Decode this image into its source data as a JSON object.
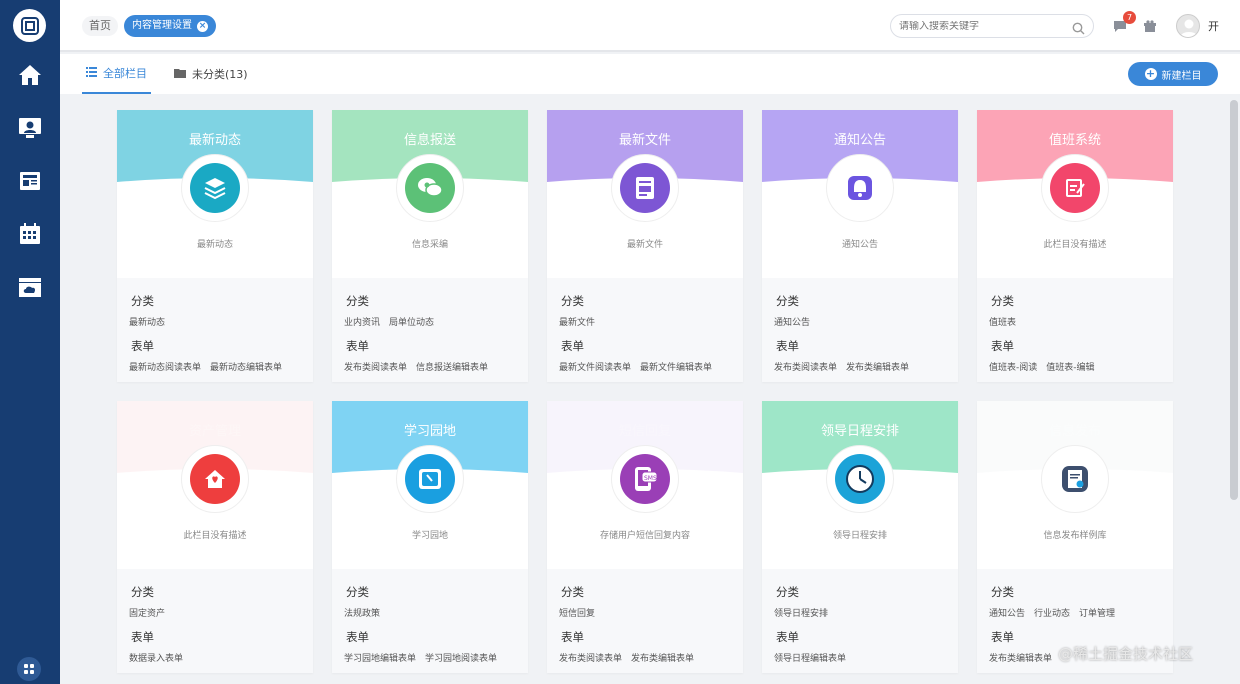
{
  "topbar": {
    "breadcrumb_home": "首页",
    "breadcrumb_active": "内容管理设置",
    "search_placeholder": "请输入搜索关键字",
    "message_count": "7",
    "user_name": "开"
  },
  "tabs": {
    "all_label": "全部栏目",
    "uncategorized_label": "未分类(13)",
    "new_button_label": "新建栏目"
  },
  "nav_icons": [
    "logo-icon",
    "home-icon",
    "user-monitor-icon",
    "newspaper-icon",
    "calendar-icon",
    "cloud-folder-icon",
    "apps-icon"
  ],
  "section_labels": {
    "category": "分类",
    "form": "表单"
  },
  "cards": [
    {
      "title": "最新动态",
      "desc": "最新动态",
      "categories": [
        "最新动态"
      ],
      "forms": [
        "最新动态阅读表单",
        "最新动态编辑表单"
      ],
      "banner_color": "#7fd3e3",
      "icon_color": "#1aa9c4",
      "icon": "layers-icon"
    },
    {
      "title": "信息报送",
      "desc": "信息采编",
      "categories": [
        "业内资讯",
        "局单位动态"
      ],
      "forms": [
        "发布类阅读表单",
        "信息报送编辑表单"
      ],
      "banner_color": "#a4e4bf",
      "icon_color": "#5cc177",
      "icon": "chat-bubbles-icon"
    },
    {
      "title": "最新文件",
      "desc": "最新文件",
      "categories": [
        "最新文件"
      ],
      "forms": [
        "最新文件阅读表单",
        "最新文件编辑表单"
      ],
      "banner_color": "#b6a0ef",
      "icon_color": "#7d56d4",
      "icon": "document-icon"
    },
    {
      "title": "通知公告",
      "desc": "通知公告",
      "categories": [
        "通知公告"
      ],
      "forms": [
        "发布类阅读表单",
        "发布类编辑表单"
      ],
      "banner_color": "#b6a5f3",
      "icon_color": "#6b55e0",
      "icon": "bell-icon"
    },
    {
      "title": "值班系统",
      "desc": "此栏目没有描述",
      "categories": [
        "值班表"
      ],
      "forms": [
        "值班表-阅读",
        "值班表-编辑"
      ],
      "banner_color": "#fca4b6",
      "icon_color": "#f2466b",
      "icon": "edit-note-icon"
    },
    {
      "title": "资产管理",
      "desc": "此栏目没有描述",
      "categories": [
        "固定资产"
      ],
      "forms": [
        "数据录入表单"
      ],
      "banner_color": "#fbd3d6",
      "icon_color": "#ee3e3e",
      "icon": "house-icon"
    },
    {
      "title": "学习园地",
      "desc": "学习园地",
      "categories": [
        "法规政策"
      ],
      "forms": [
        "学习园地编辑表单",
        "学习园地阅读表单"
      ],
      "banner_color": "#7fd3f3",
      "icon_color": "#1a9fe0",
      "icon": "book-icon"
    },
    {
      "title": "短信回复",
      "desc": "存储用户短信回复内容",
      "categories": [
        "短信回复"
      ],
      "forms": [
        "发布类阅读表单",
        "发布类编辑表单"
      ],
      "banner_color": "#e2d4f4",
      "icon_color": "#9a3fb6",
      "icon": "sms-icon"
    },
    {
      "title": "领导日程安排",
      "desc": "领导日程安排",
      "categories": [
        "领导日程安排"
      ],
      "forms": [
        "领导日程编辑表单"
      ],
      "banner_color": "#9ee6c8",
      "icon_color": "#1ca3d8",
      "icon": "clock-icon"
    },
    {
      "title": "信息发布",
      "desc": "信息发布样例库",
      "categories": [
        "通知公告",
        "行业动态",
        "订单管理"
      ],
      "forms": [
        "发布类编辑表单"
      ],
      "banner_color": "#eef0f2",
      "icon_color": "#3d4f6e",
      "icon": "certificate-icon"
    }
  ],
  "watermark": "@稀土掘金技术社区"
}
